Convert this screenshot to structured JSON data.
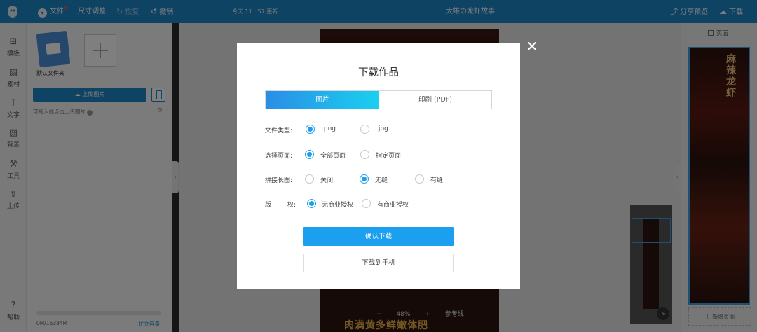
{
  "topbar": {
    "file_label": "文件",
    "resize_label": "尺寸调整",
    "redo_label": "恢复",
    "undo_label": "撤销",
    "save_status": "今天 11 : 57 更新",
    "doc_title": "大雄の龙虾故事",
    "share_label": "分享预览",
    "download_label": "下载"
  },
  "rail": {
    "items": [
      {
        "label": "模板",
        "icon": "template-icon"
      },
      {
        "label": "素材",
        "icon": "image-icon"
      },
      {
        "label": "文字",
        "icon": "text-icon"
      },
      {
        "label": "背景",
        "icon": "background-icon"
      },
      {
        "label": "工具",
        "icon": "tools-icon"
      },
      {
        "label": "上传",
        "icon": "upload-icon"
      }
    ],
    "help_label": "帮助"
  },
  "left_panel": {
    "folder_label": "默认文件夹",
    "upload_label": "上传图片",
    "drag_hint": "可拖入或点击上传图片",
    "storage_text": "0M/16384M",
    "expand_label": "扩充容量"
  },
  "canvas": {
    "zoom_minus": "−",
    "zoom_level": "48%",
    "zoom_plus": "+",
    "guides_label": "参考线",
    "poster_slogan": "肉满黄多鲜嫩体肥"
  },
  "right_panel": {
    "title": "页面",
    "thumb_title": "麻辣龙虾",
    "new_page_label": "新增页面"
  },
  "modal": {
    "title": "下载作品",
    "tabs": [
      "图片",
      "印刷 (PDF)"
    ],
    "active_tab": "图片",
    "rows": {
      "file_type": {
        "label": "文件类型:",
        "options": [
          ".png",
          ".jpg"
        ],
        "selected": ".png"
      },
      "pages": {
        "label": "选择页面:",
        "options": [
          "全部页面",
          "指定页面"
        ],
        "selected": "全部页面"
      },
      "stitch": {
        "label": "拼接长图:",
        "options": [
          "关闭",
          "无缝",
          "有缝"
        ],
        "selected": "无缝"
      },
      "license": {
        "label": "版        权:",
        "options": [
          "无商业授权",
          "有商业授权"
        ],
        "selected": "无商业授权"
      }
    },
    "confirm_label": "确认下载",
    "phone_label": "下载到手机"
  },
  "colors": {
    "topbar": "#1f86c9",
    "accent": "#1ba0ef",
    "tab_gradient_start": "#2b8de6",
    "tab_gradient_end": "#1ad0f0"
  }
}
